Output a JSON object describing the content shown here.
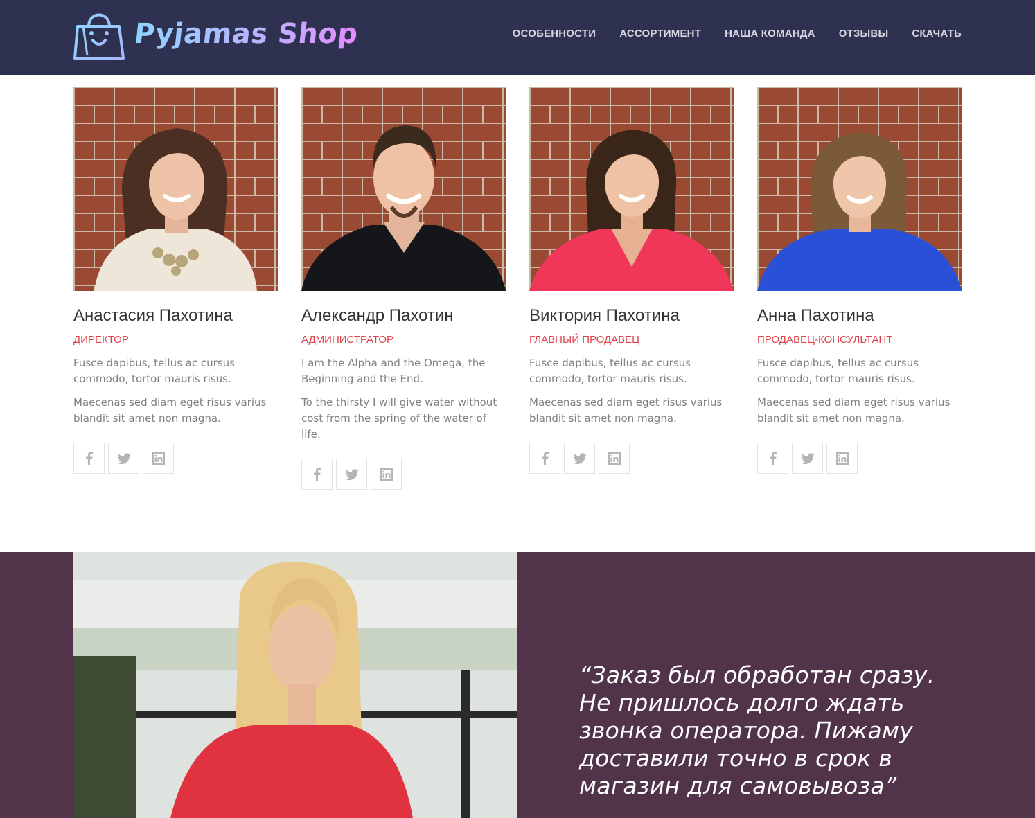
{
  "brand": {
    "name": "Pyjamas Shop",
    "logo_icon": "shopping-bag-icon"
  },
  "nav": {
    "items": [
      "ОСОБЕННОСТИ",
      "АССОРТИМЕНТ",
      "НАША КОМАНДА",
      "ОТЗЫВЫ",
      "СКАЧАТЬ"
    ]
  },
  "team": [
    {
      "name": "Анастасия Пахотина",
      "role": "Директор",
      "p1": "Fusce dapibus, tellus ac cursus commodo, tortor mauris risus.",
      "p2": "Maecenas sed diam eget risus varius blandit sit amet non magna.",
      "socials": [
        "facebook-icon",
        "twitter-icon",
        "linkedin-icon"
      ]
    },
    {
      "name": "Александр Пахотин",
      "role": "Администратор",
      "p1": "I am the Alpha and the Omega, the Beginning and the End.",
      "p2": "To the thirsty I will give water without cost from the spring of the water of life.",
      "socials": [
        "facebook-icon",
        "twitter-icon",
        "linkedin-icon"
      ]
    },
    {
      "name": "Виктория Пахотина",
      "role": "Главный продавец",
      "p1": "Fusce dapibus, tellus ac cursus commodo, tortor mauris risus.",
      "p2": "Maecenas sed diam eget risus varius blandit sit amet non magna.",
      "socials": [
        "facebook-icon",
        "twitter-icon",
        "linkedin-icon"
      ]
    },
    {
      "name": "Анна Пахотина",
      "role": "Продавец-консультант",
      "p1": "Fusce dapibus, tellus ac cursus commodo, tortor mauris risus.",
      "p2": "Maecenas sed diam eget risus varius blandit sit amet non magna.",
      "socials": [
        "facebook-icon",
        "twitter-icon",
        "linkedin-icon"
      ]
    }
  ],
  "testimonial": {
    "quote": "“Заказ был обработан сразу. Не пришлось долго ждать звонка оператора. Пижаму доставили точно в срок в магазин для самовывоза”"
  },
  "colors": {
    "header_bg": "#2f3150",
    "role_accent": "#e0424c",
    "testimonial_bg": "#52344a"
  }
}
